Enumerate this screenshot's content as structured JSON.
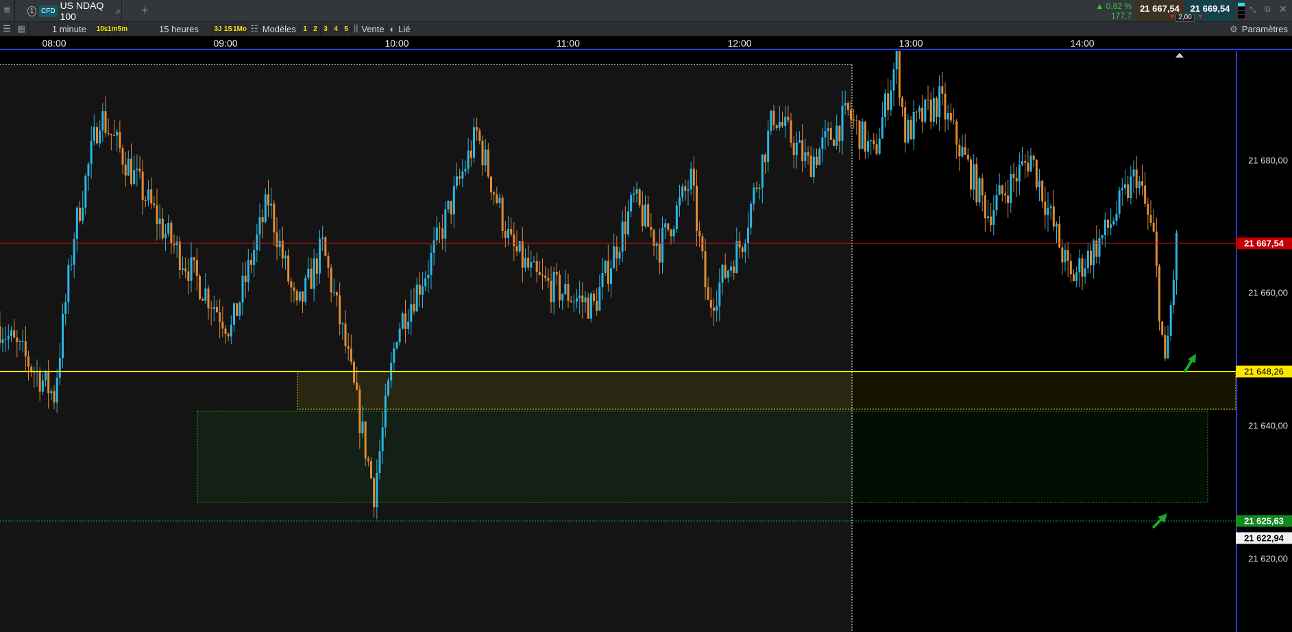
{
  "toolbar": {
    "menu_icon": "hamburger-icon",
    "tab_number": "1",
    "tab_badge": "CFD",
    "instrument": "US NDAQ 100",
    "add_tab": "+",
    "interval": "1 minute",
    "intervals": [
      "10s",
      "1m",
      "5m"
    ],
    "range": "15 heures",
    "ranges": [
      "3J",
      "1S",
      "1Mo"
    ],
    "templates": "Modèles",
    "slots": [
      "1",
      "2",
      "3",
      "4",
      "5"
    ],
    "chart_type": "Vente",
    "linked": "Lié",
    "settings": "Paramètres"
  },
  "quote": {
    "change_pct": "0,82 %",
    "change_pts": "177,7",
    "bid": "21 667,54",
    "ask": "21 669,54",
    "spread": "2,00",
    "up_color": "#2ecc40",
    "bid_bg": "#3d3224",
    "ask_bg": "#17414a"
  },
  "time_axis": [
    "08:00",
    "09:00",
    "10:00",
    "11:00",
    "12:00",
    "13:00",
    "14:00"
  ],
  "price_axis": [
    "21 680,00",
    "21 660,00",
    "21 640,00",
    "21 620,00"
  ],
  "price_tags": {
    "last": "21 667,54",
    "yellow": "21 648,26",
    "green": "21 625,63",
    "low": "21 622,94"
  },
  "colors": {
    "up": "#2ab7e3",
    "down": "#e08c35",
    "red_line": "#e01010",
    "yellow": "#ffe600",
    "green": "#1aa72a"
  },
  "price_path": [
    [
      "07:41",
      21655
    ],
    [
      "08:00",
      21644.6
    ],
    [
      "08:07",
      21669
    ],
    [
      "08:16",
      21687
    ],
    [
      "08:39",
      21669
    ],
    [
      "09:02",
      21654.5
    ],
    [
      "09:15",
      21674
    ],
    [
      "09:25",
      21657
    ],
    [
      "09:34",
      21667
    ],
    [
      "09:42",
      21652
    ],
    [
      "09:52",
      21630
    ],
    [
      "10:00",
      21654.5
    ],
    [
      "10:11",
      21664
    ],
    [
      "10:28",
      21684
    ],
    [
      "10:40",
      21667
    ],
    [
      "10:49",
      21662
    ],
    [
      "11:09",
      21658
    ],
    [
      "11:23",
      21674
    ],
    [
      "11:32",
      21667
    ],
    [
      "11:43",
      21677
    ],
    [
      "11:49",
      21658
    ],
    [
      "12:01",
      21668
    ],
    [
      "12:12",
      21687
    ],
    [
      "12:24",
      21679.4
    ],
    [
      "12:38",
      21687
    ],
    [
      "12:47",
      21680.6
    ],
    [
      "12:55",
      21695.5
    ],
    [
      "12:58",
      21684
    ],
    [
      "13:10",
      21689
    ],
    [
      "13:27",
      21672
    ],
    [
      "13:42",
      21680.6
    ],
    [
      "13:56",
      21662
    ],
    [
      "14:08",
      21669
    ],
    [
      "14:19",
      21678
    ],
    [
      "14:25",
      21668
    ],
    [
      "14:29",
      21648.3
    ],
    [
      "14:33",
      21667.5
    ]
  ]
}
